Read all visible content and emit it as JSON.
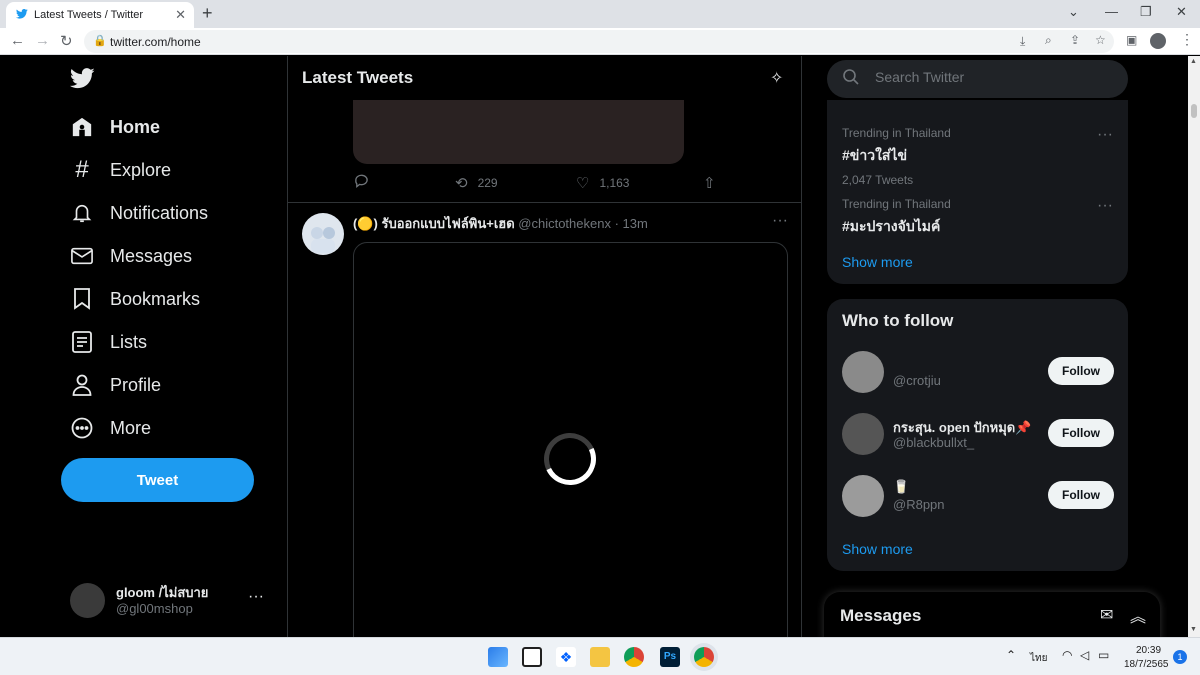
{
  "browser": {
    "tab_title": "Latest Tweets / Twitter",
    "url": "twitter.com/home",
    "icons": [
      "twitter-icon",
      "close-icon",
      "plus-icon",
      "back-icon",
      "forward-icon",
      "reload-icon",
      "lock-icon",
      "install-icon",
      "zoom-icon",
      "share-icon",
      "bookmark-star-icon",
      "sidepanel-icon",
      "profile-icon",
      "menu-icon"
    ]
  },
  "nav": {
    "items": [
      {
        "label": "Home",
        "icon": "home-icon"
      },
      {
        "label": "Explore",
        "icon": "hashtag-icon"
      },
      {
        "label": "Notifications",
        "icon": "bell-icon"
      },
      {
        "label": "Messages",
        "icon": "envelope-icon"
      },
      {
        "label": "Bookmarks",
        "icon": "bookmark-icon"
      },
      {
        "label": "Lists",
        "icon": "list-icon"
      },
      {
        "label": "Profile",
        "icon": "person-icon"
      },
      {
        "label": "More",
        "icon": "more-circle-icon"
      }
    ],
    "tweet_button": "Tweet",
    "account": {
      "name": "gloom /ไม่สบาย",
      "handle": "@gl00mshop"
    }
  },
  "timeline": {
    "title": "Latest Tweets",
    "prev_tweet_actions": {
      "retweets": "229",
      "likes": "1,163"
    },
    "tweet": {
      "name": "(🟡) รับออกแบบไฟล์พิน+เฮด",
      "handle": "@chictothekenx",
      "time": "· 13m"
    }
  },
  "sidebar": {
    "search_placeholder": "Search Twitter",
    "trends": [
      {
        "context": "Trending in Thailand",
        "tag": "#ข่าวใส่ไข่",
        "count": "2,047 Tweets"
      },
      {
        "context": "Trending in Thailand",
        "tag": "#มะปรางจับไมค์",
        "count": ""
      }
    ],
    "trends_show_more": "Show more",
    "who_to_follow": {
      "title": "Who to follow",
      "users": [
        {
          "name": "",
          "handle": "@crotjiu",
          "button": "Follow"
        },
        {
          "name": "กระสุน. open ปักหมุด📌",
          "handle": "@blackbullxt_",
          "button": "Follow"
        },
        {
          "name": "🥛",
          "handle": "@R8ppn",
          "button": "Follow"
        }
      ],
      "show_more": "Show more"
    },
    "messages_drawer": "Messages"
  },
  "taskbar": {
    "lang": "ไทย",
    "time": "20:39",
    "date": "18/7/2565",
    "notifications": "1"
  },
  "colors": {
    "accent": "#1d9bf0",
    "background": "#000000",
    "panel": "#16181c"
  }
}
